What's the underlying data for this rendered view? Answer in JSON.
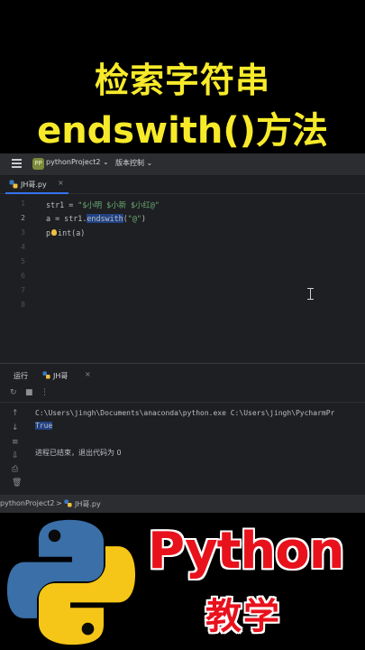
{
  "video_title": {
    "line1": "检索字符串",
    "line2": "endswith()方法"
  },
  "ide": {
    "topbar": {
      "project_badge": "PP",
      "project_name": "pythonProject2",
      "project_chevron": "⌄",
      "vcs_label": "版本控制",
      "vcs_chevron": "⌄"
    },
    "editor_tab": {
      "file_name": "JH哥.py",
      "close": "×"
    },
    "line_numbers": [
      "1",
      "2",
      "3",
      "4",
      "5",
      "6",
      "7",
      "8"
    ],
    "code": {
      "line1_prefix": "str1 = ",
      "line1_string": "\"$小明 $小新 $小红@\"",
      "line2_prefix": "a = str1.",
      "line2_method": "endswith",
      "line2_paren_open": "(",
      "line2_arg": "\"@\"",
      "line2_paren_close": ")",
      "line3_p": "p",
      "line3_rest": "int(a)"
    },
    "run_panel": {
      "label": "运行",
      "tab_name": "JH哥",
      "tab_close": "×",
      "output_command": "C:\\Users\\jingh\\Documents\\anaconda\\python.exe C:\\Users\\jingh\\PycharmPr",
      "output_result": "True",
      "output_exit": "进程已结束，退出代码为 0"
    },
    "breadcrumb": {
      "project": "pythonProject2",
      "separator": ">",
      "file": "JH哥.py"
    }
  },
  "brand": {
    "word": "Python",
    "sub": "教学",
    "logo_blue": "#3a6fa8",
    "logo_yellow": "#f5c518",
    "text_red": "#e8121c"
  },
  "colors": {
    "title_yellow": "#f7ea2a",
    "ide_bg": "#1e1f22",
    "string_green": "#6aab73",
    "selection_blue": "#214283"
  }
}
